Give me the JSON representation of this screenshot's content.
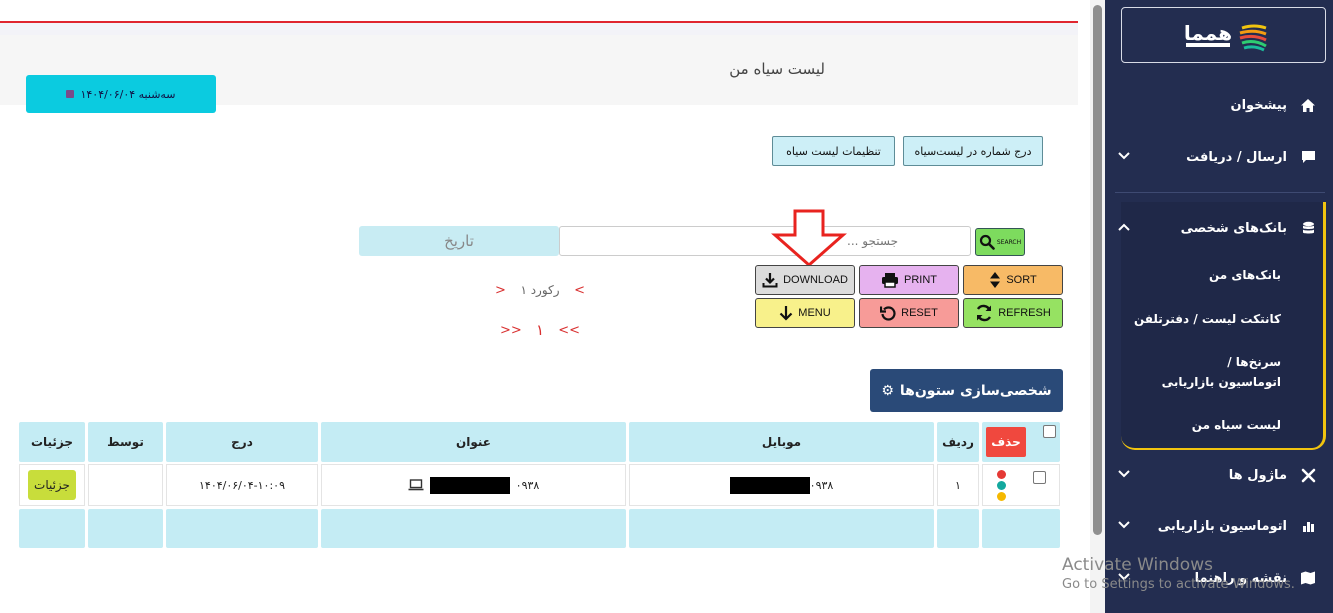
{
  "header": {
    "page_title": "لیست سیاه من",
    "date_badge": "سه‌شنبه ۱۴۰۴/۰۶/۰۴"
  },
  "toolbar": {
    "insert_label": "درج شماره در لیست‌سیاه",
    "settings_label": "تنظیمات لیست سیاه"
  },
  "search": {
    "date_label": "تاریخ",
    "placeholder": "جستجو ...",
    "search_label": "SEARCH"
  },
  "actions": {
    "download": "DOWNLOAD",
    "print": "PRINT",
    "sort": "SORT",
    "menu": "MENU",
    "reset": "RESET",
    "refresh": "REFRESH"
  },
  "pagination": {
    "records": "۱ رکورد",
    "prev": "<",
    "next": ">",
    "first": "<<",
    "last": ">>",
    "page": "۱"
  },
  "customize": {
    "label": "شخصی‌سازی ستون‌ها"
  },
  "table": {
    "headers": {
      "delete": "حذف",
      "row": "ردیف",
      "mobile": "موبایل",
      "title": "عنوان",
      "inserted": "درج",
      "by": "توسط",
      "details": "جزئیات"
    },
    "rows": [
      {
        "row": "۱",
        "mobile_prefix": "۰۹۳۸",
        "title_prefix": "۰۹۳۸",
        "inserted": "۱۴۰۴/۰۶/۰۴-۱۰:۰۹",
        "by": "",
        "details_label": "جزئیات"
      }
    ]
  },
  "status_colors": [
    "#e53935",
    "#13a89e",
    "#f5b800"
  ],
  "sidebar": {
    "logo_text": "همما",
    "items": [
      {
        "label": "پیشخوان",
        "icon": "home-icon"
      },
      {
        "label": "ارسال / دریافت",
        "icon": "chat-icon"
      },
      {
        "label": "بانک‌های شخصی",
        "icon": "database-icon"
      },
      {
        "label": "ماژول ها",
        "icon": "tools-icon"
      },
      {
        "label": "اتوماسیون بازاریابی",
        "icon": "chart-icon"
      },
      {
        "label": "نقشه و راهنما",
        "icon": "map-icon"
      }
    ],
    "subitems": [
      "بانک‌های من",
      "کانتکت لیست / دفترتلفن",
      "سرنخ‌ها / اتوماسیون بازاریابی",
      "لیست سیاه من"
    ]
  },
  "watermark": {
    "line1": "Activate Windows",
    "line2": "Go to Settings to activate Windows."
  }
}
